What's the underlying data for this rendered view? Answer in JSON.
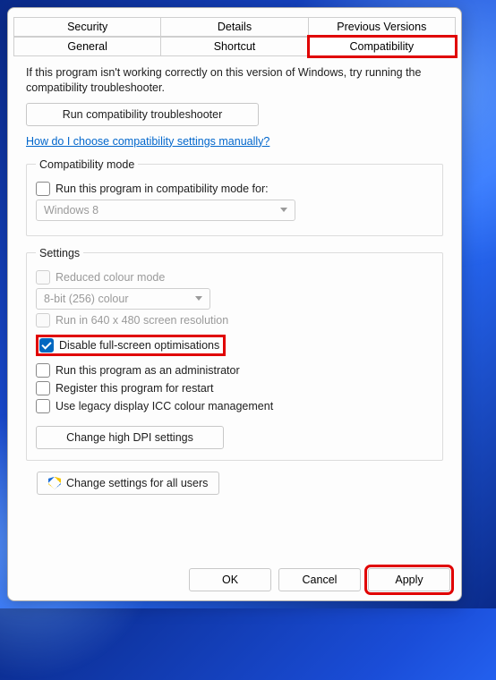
{
  "tabs": {
    "row1": [
      "Security",
      "Details",
      "Previous Versions"
    ],
    "row2": [
      "General",
      "Shortcut",
      "Compatibility"
    ],
    "active": "Compatibility"
  },
  "intro": "If this program isn't working correctly on this version of Windows, try running the compatibility troubleshooter.",
  "troubleshooter_btn": "Run compatibility troubleshooter",
  "help_link": "How do I choose compatibility settings manually?",
  "compat_mode": {
    "legend": "Compatibility mode",
    "checkbox": "Run this program in compatibility mode for:",
    "select": "Windows 8"
  },
  "settings": {
    "legend": "Settings",
    "reduced_colour": "Reduced colour mode",
    "colour_select": "8-bit (256) colour",
    "run_640": "Run in 640 x 480 screen resolution",
    "disable_fullscreen": "Disable full-screen optimisations",
    "run_admin": "Run this program as an administrator",
    "register_restart": "Register this program for restart",
    "legacy_icc": "Use legacy display ICC colour management",
    "high_dpi_btn": "Change high DPI settings"
  },
  "all_users_btn": "Change settings for all users",
  "footer": {
    "ok": "OK",
    "cancel": "Cancel",
    "apply": "Apply"
  }
}
